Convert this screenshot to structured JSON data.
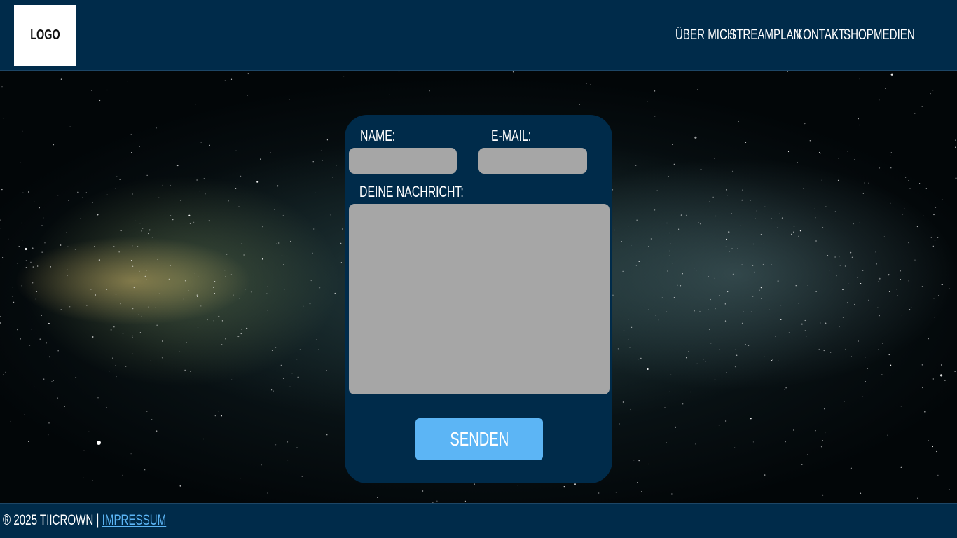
{
  "header": {
    "logo_text": "LOGO",
    "nav": [
      {
        "label": "Über mich"
      },
      {
        "label": "Streamplan"
      },
      {
        "label": "Kontakt"
      },
      {
        "label": "Shop"
      },
      {
        "label": "Medien"
      }
    ]
  },
  "form": {
    "name_label": "Name:",
    "email_label": "E-Mail:",
    "message_label": "Deine Nachricht:",
    "name_value": "",
    "email_value": "",
    "message_value": "",
    "submit_label": "Senden"
  },
  "footer": {
    "copyright": "® 2025 Tiicrown |",
    "impressum_label": "Impressum"
  },
  "colors": {
    "header_bg": "#002b4a",
    "card_bg": "#002b4a",
    "input_bg": "#a6a6a6",
    "accent": "#5cb5f5"
  }
}
